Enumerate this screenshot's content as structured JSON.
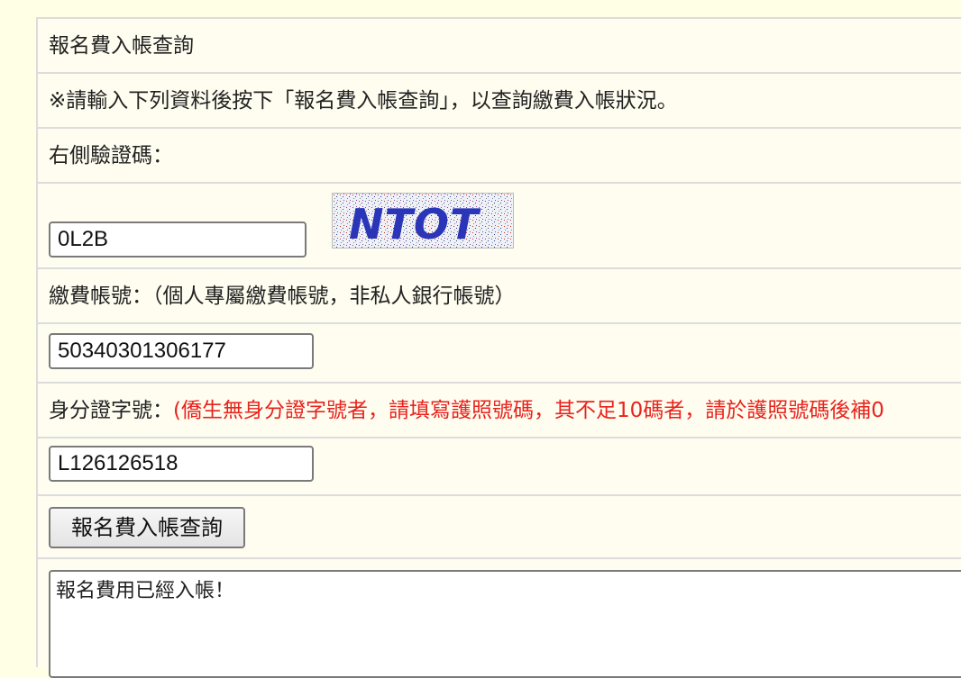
{
  "form": {
    "title": "報名費入帳查詢",
    "instruction": "※請輸入下列資料後按下「報名費入帳查詢」，以查詢繳費入帳狀況。",
    "captcha_label": "右側驗證碼：",
    "captcha_value": "0L2B",
    "captcha_image_text": "NTOT",
    "account_label": "繳費帳號：",
    "account_note": "（個人專屬繳費帳號，非私人銀行帳號）",
    "account_value": "50340301306177",
    "id_label": "身分證字號：",
    "id_note": "(僑生無身分證字號者，請填寫護照號碼，其不足10碼者，請於護照號碼後補0",
    "id_value": "L126126518",
    "submit_label": "報名費入帳查詢",
    "result_text": "報名費用已經入帳！"
  },
  "colors": {
    "page_bg": "#ffffe6",
    "note_red": "#e8231d",
    "border": "#dcdcdc"
  }
}
